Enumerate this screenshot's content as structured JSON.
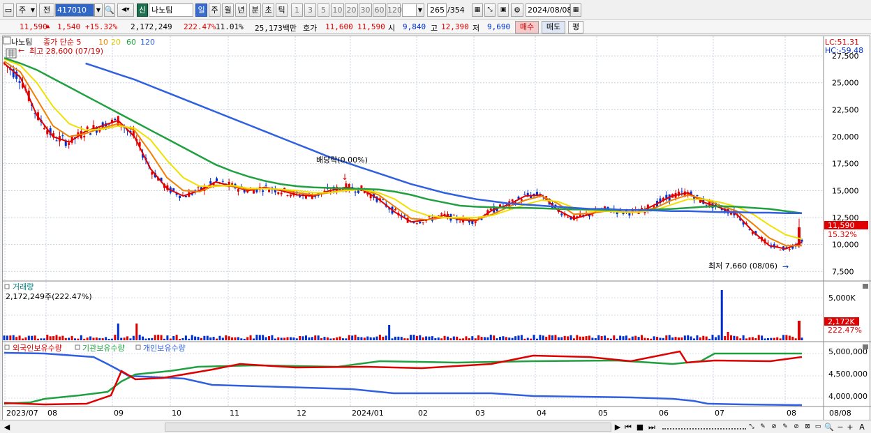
{
  "toolbar": {
    "period": "주",
    "prev": "전",
    "code": "417010",
    "stock_name": "나노팀",
    "stock_badge": "신",
    "periods": [
      "일",
      "주",
      "월",
      "년",
      "분",
      "초",
      "틱"
    ],
    "nums": [
      "1",
      "3",
      "5",
      "10",
      "20",
      "30",
      "60",
      "120"
    ],
    "count": "265",
    "total": "/354",
    "date": "2024/08/08"
  },
  "quote": {
    "price": "11,590",
    "change": "1,540",
    "change_pct": "+15.32%",
    "volume": "2,172,249",
    "vol_ratio": "222.47%",
    "turnover": "11.01%",
    "amount": "25,173백만",
    "ask_label": "호가",
    "ask": "11,600",
    "bid": "11,590",
    "open_label": "시",
    "open": "9,840",
    "high_label": "고",
    "high": "12,390",
    "low_label": "저",
    "low": "9,690",
    "buy": "매수",
    "sell": "매도",
    "eval": "평"
  },
  "price_panel": {
    "name": "나노팀",
    "ma_label": "종가 단순 5",
    "ma": [
      "10",
      "20",
      "60",
      "120"
    ],
    "high_note": "최고 28,600 (07/19)",
    "low_note": "최저 7,660 (08/06)",
    "div_note": "배당락(0.00%)",
    "lc": "LC:51.31",
    "hc": "HC:-59.48",
    "yticks": [
      "27,500",
      "25,000",
      "22,500",
      "20,000",
      "17,500",
      "15,000",
      "12,500",
      "10,000",
      "7,500"
    ],
    "price_tag": "11,590",
    "pct_tag": "15.32%"
  },
  "volume_panel": {
    "title": "거래량",
    "value": "2,172,249주(222.47%)",
    "yticks": [
      "5,000K",
      "2,500K"
    ],
    "tag": "2,172K",
    "tag_pct": "222.47%"
  },
  "holding_panel": {
    "foreign": "외국인보유수량",
    "inst": "기관보유수량",
    "indiv": "개인보유수량",
    "yticks": [
      "5,000,000",
      "4,500,000",
      "4,000,000"
    ]
  },
  "xaxis": [
    "2023/07",
    "08",
    "09",
    "10",
    "11",
    "12",
    "2024/01",
    "02",
    "03",
    "04",
    "05",
    "06",
    "07",
    "08"
  ],
  "xaxis_right": "08/08",
  "colors": {
    "up": "#e00000",
    "down": "#0030d0",
    "ma5": "#e00000",
    "ma10": "#f08000",
    "ma20": "#f0e000",
    "ma60": "#20a040",
    "ma120": "#3060e0"
  },
  "chart_data": {
    "type": "line",
    "series": [
      {
        "name": "5",
        "values": [
          26800,
          25500,
          22000,
          20000,
          19500,
          20500,
          21000,
          21500,
          20000,
          17000,
          15200,
          14500,
          15000,
          15800,
          15400,
          15000,
          15300,
          15000,
          14600,
          14500,
          15000,
          15300,
          15100,
          14200,
          13000,
          12100,
          12300,
          12700,
          12300,
          12200,
          13200,
          13700,
          14500,
          14600,
          13200,
          12400,
          12800,
          13300,
          13000,
          13000,
          13700,
          14500,
          14800,
          13900,
          13400,
          12800,
          11200,
          9900,
          9600,
          10200
        ]
      },
      {
        "name": "10",
        "values": [
          27000,
          26000,
          23500,
          21000,
          20000,
          20300,
          20800,
          21200,
          20600,
          18500,
          16200,
          15000,
          14900,
          15500,
          15400,
          15100,
          15200,
          15100,
          14800,
          14600,
          14800,
          15100,
          15100,
          14600,
          13500,
          12400,
          12300,
          12500,
          12400,
          12300,
          12800,
          13500,
          14100,
          14500,
          13800,
          12800,
          12900,
          13100,
          13000,
          13000,
          13400,
          14100,
          14600,
          14200,
          13600,
          13100,
          11900,
          10600,
          9900,
          9900
        ]
      },
      {
        "name": "20",
        "values": [
          27200,
          26600,
          25000,
          22800,
          21200,
          20600,
          20700,
          21000,
          20800,
          19700,
          17800,
          16200,
          15400,
          15400,
          15500,
          15200,
          15200,
          15100,
          15000,
          14800,
          14800,
          15000,
          15100,
          14800,
          14200,
          13200,
          12700,
          12500,
          12500,
          12500,
          12700,
          13200,
          13700,
          14100,
          14000,
          13400,
          13100,
          13100,
          13000,
          13000,
          13200,
          13700,
          14200,
          14200,
          13900,
          13500,
          12800,
          11800,
          10900,
          10500
        ]
      },
      {
        "name": "60",
        "values": [
          27300,
          26800,
          26200,
          25400,
          24600,
          23800,
          23000,
          22200,
          21400,
          20600,
          19800,
          19000,
          18200,
          17400,
          16800,
          16300,
          15900,
          15600,
          15400,
          15300,
          15250,
          15200,
          15150,
          15100,
          14900,
          14600,
          14200,
          13900,
          13600,
          13500,
          13450,
          13400,
          13400,
          13350,
          13300,
          13250,
          13250,
          13200,
          13200,
          13200,
          13250,
          13300,
          13400,
          13500,
          13550,
          13500,
          13400,
          13300,
          13100,
          12900
        ]
      },
      {
        "name": "120",
        "values": [
          null,
          null,
          null,
          null,
          null,
          26800,
          26300,
          25800,
          25300,
          24700,
          24100,
          23500,
          22900,
          22300,
          21700,
          21100,
          20500,
          19900,
          19300,
          18700,
          18100,
          17600,
          17100,
          16600,
          16100,
          15600,
          15200,
          14800,
          14500,
          14200,
          14000,
          13800,
          13700,
          13600,
          13500,
          13400,
          13300,
          13300,
          13200,
          13200,
          13150,
          13100,
          13100,
          13050,
          13000,
          13000,
          12950,
          12950,
          12900,
          12900
        ]
      }
    ],
    "ylim": [
      7000,
      28800
    ]
  }
}
